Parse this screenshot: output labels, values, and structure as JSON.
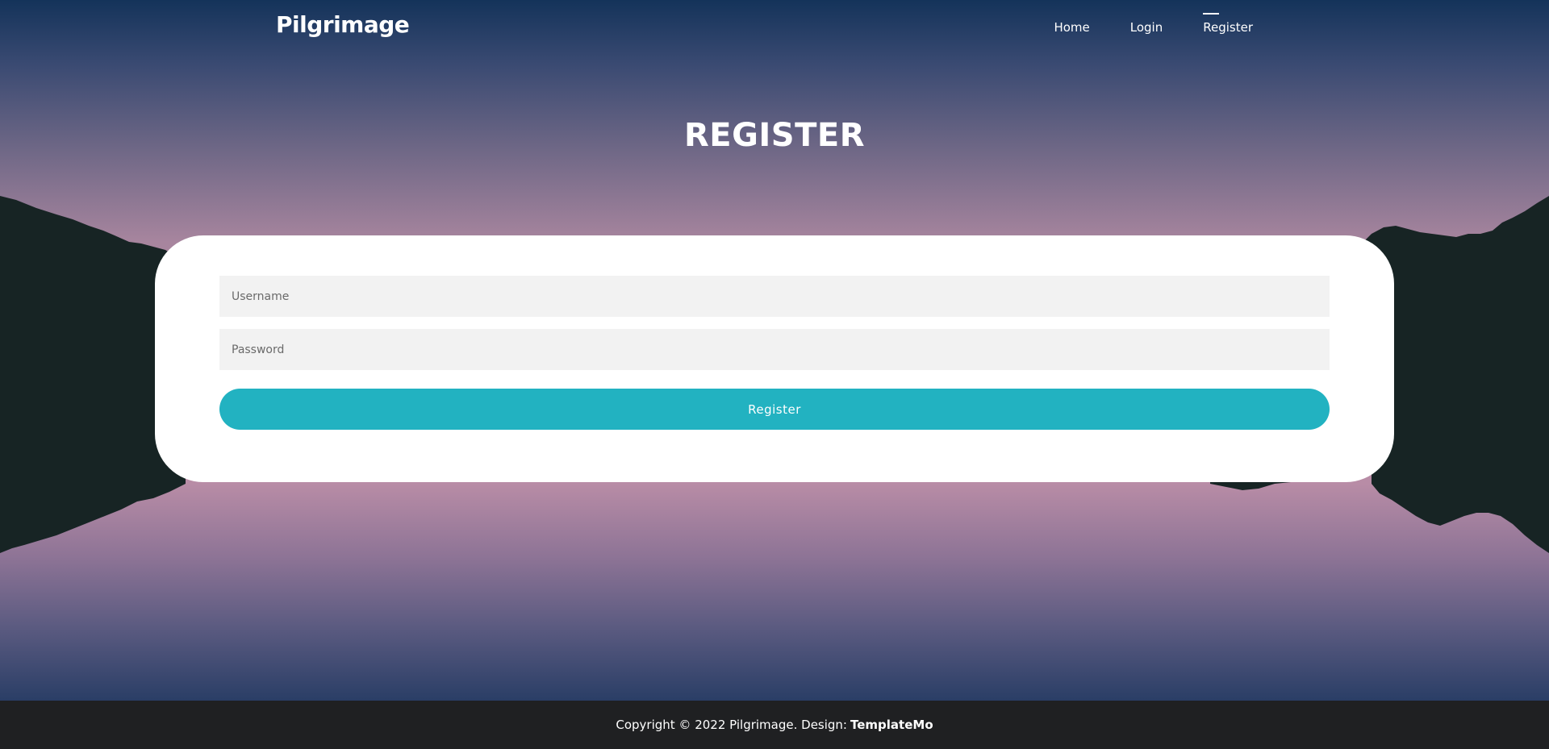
{
  "brand": "Pilgrimage",
  "nav": {
    "home": "Home",
    "login": "Login",
    "register": "Register"
  },
  "page_title": "REGISTER",
  "form": {
    "username_placeholder": "Username",
    "password_placeholder": "Password",
    "submit_label": "Register"
  },
  "footer": {
    "copyright": "Copyright © 2022 Pilgrimage. Design:",
    "link": "TemplateMo"
  },
  "colors": {
    "accent": "#22b2c1",
    "footer_bg": "#1f2022",
    "field_bg": "#f2f2f2"
  }
}
